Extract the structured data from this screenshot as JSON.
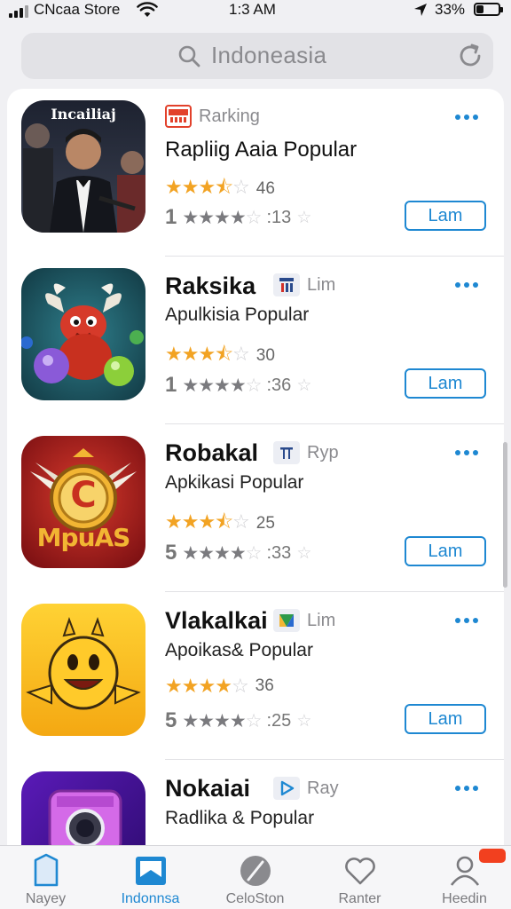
{
  "status_bar": {
    "carrier": "CNcaa Store",
    "time": "1:3 AM",
    "battery_percent": "33%",
    "battery_level": 0.33
  },
  "search": {
    "query": "Indoneasia"
  },
  "apps": [
    {
      "name": "Rapliig Aaia Popular",
      "badge": "Rarking",
      "category": "",
      "rating_count": "46",
      "stars": 3.5,
      "sub_number": "1",
      "sub_count": ":13",
      "button": "Lam",
      "icon_label": "Incailiaj"
    },
    {
      "name": "Raksika",
      "badge": "Lim",
      "category": "Apulkisia Popular",
      "rating_count": "30",
      "stars": 3.5,
      "sub_number": "1",
      "sub_count": ":36",
      "button": "Lam"
    },
    {
      "name": "Robakal",
      "badge": "Ryp",
      "category": "Apkikasi Popular",
      "rating_count": "25",
      "stars": 3.5,
      "sub_number": "5",
      "sub_count": ":33",
      "button": "Lam",
      "icon_label": "MpuAS",
      "icon_letter": "C"
    },
    {
      "name": "Vlakalkai",
      "badge": "Lim",
      "category": "Apoikas& Popular",
      "rating_count": "36",
      "stars": 4,
      "sub_number": "5",
      "sub_count": ":25",
      "button": "Lam"
    },
    {
      "name": "Nokaiai",
      "badge": "Ray",
      "category": "Radlika & Popular"
    }
  ],
  "tabs": [
    {
      "label": "Nayey",
      "icon": "today-icon",
      "active": false
    },
    {
      "label": "Indonnsa",
      "icon": "apps-icon",
      "active": true
    },
    {
      "label": "CeloSton",
      "icon": "games-icon",
      "active": false
    },
    {
      "label": "Ranter",
      "icon": "heart-icon",
      "active": false
    },
    {
      "label": "Heedin",
      "icon": "person-icon",
      "active": false
    }
  ],
  "colors": {
    "accent": "#1e88d2",
    "star": "#f2a323",
    "badge_alert": "#f2401f"
  }
}
